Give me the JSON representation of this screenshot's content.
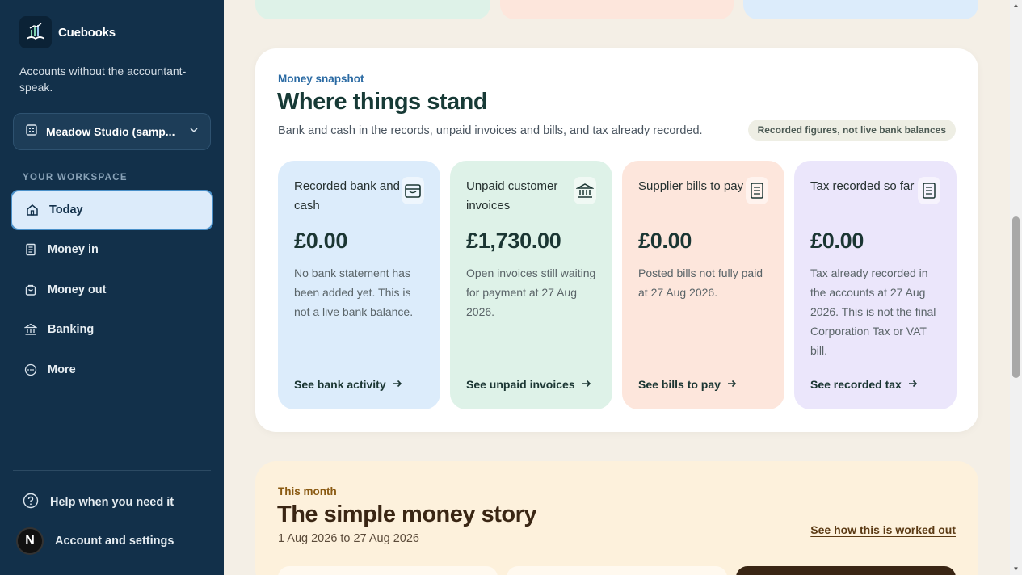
{
  "brand": {
    "name": "Cuebooks",
    "tagline": "Accounts without the accountant-speak."
  },
  "org": {
    "name": "Meadow Studio (samp..."
  },
  "sidebar": {
    "section_label": "YOUR WORKSPACE",
    "items": [
      {
        "label": "Today",
        "icon": "home-icon",
        "active": true
      },
      {
        "label": "Money in",
        "icon": "document-icon"
      },
      {
        "label": "Money out",
        "icon": "bag-icon"
      },
      {
        "label": "Banking",
        "icon": "bank-icon"
      },
      {
        "label": "More",
        "icon": "more-icon"
      }
    ],
    "help_label": "Help when you need it",
    "account_label": "Account and settings",
    "avatar_initial": "N"
  },
  "snapshot": {
    "eyebrow": "Money snapshot",
    "title": "Where things stand",
    "subtitle": "Bank and cash in the records, unpaid invoices and bills, and tax already recorded.",
    "pill": "Recorded figures, not live bank balances",
    "cards": [
      {
        "label": "Recorded bank and cash",
        "amount": "£0.00",
        "desc": "No bank statement has been added yet. This is not a live bank balance.",
        "link": "See bank activity",
        "color": "#dcecfb",
        "icon": "wallet-icon"
      },
      {
        "label": "Unpaid customer invoices",
        "amount": "£1,730.00",
        "desc": "Open invoices still waiting for payment at 27 Aug 2026.",
        "link": "See unpaid invoices",
        "color": "#def2e8",
        "icon": "bank-icon"
      },
      {
        "label": "Supplier bills to pay",
        "amount": "£0.00",
        "desc": "Posted bills not fully paid at 27 Aug 2026.",
        "link": "See bills to pay",
        "color": "#fde6dc",
        "icon": "receipt-icon"
      },
      {
        "label": "Tax recorded so far",
        "amount": "£0.00",
        "desc": "Tax already recorded in the accounts at 27 Aug 2026. This is not the final Corporation Tax or VAT bill.",
        "link": "See recorded tax",
        "color": "#ebe6fb",
        "icon": "receipt-icon"
      }
    ]
  },
  "story": {
    "eyebrow": "This month",
    "title": "The simple money story",
    "range": "1 Aug 2026 to 27 Aug 2026",
    "link": "See how this is worked out"
  },
  "colors": {
    "sidebar": "#12304a",
    "accent": "#4a90c9"
  }
}
